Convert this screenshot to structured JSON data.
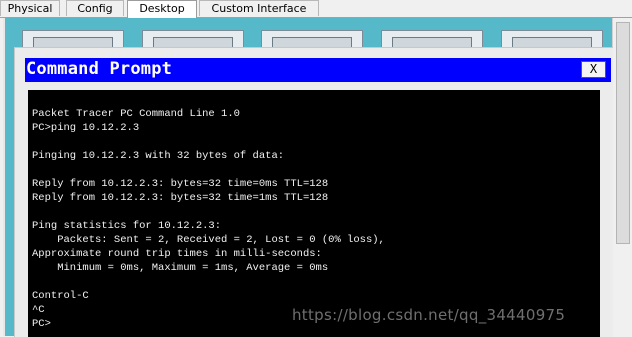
{
  "tabs": [
    {
      "label": "Physical"
    },
    {
      "label": "Config"
    },
    {
      "label": "Desktop",
      "active": true
    },
    {
      "label": "Custom Interface"
    }
  ],
  "window": {
    "title": "Command Prompt",
    "close_label": "X"
  },
  "terminal": {
    "lines": [
      "Packet Tracer PC Command Line 1.0",
      "PC>ping 10.12.2.3",
      "",
      "Pinging 10.12.2.3 with 32 bytes of data:",
      "",
      "Reply from 10.12.2.3: bytes=32 time=0ms TTL=128",
      "Reply from 10.12.2.3: bytes=32 time=1ms TTL=128",
      "",
      "Ping statistics for 10.12.2.3:",
      "    Packets: Sent = 2, Received = 2, Lost = 0 (0% loss),",
      "Approximate round trip times in milli-seconds:",
      "    Minimum = 0ms, Maximum = 1ms, Average = 0ms",
      "",
      "Control-C",
      "^C",
      "PC>"
    ]
  },
  "watermark": "https://blog.csdn.net/qq_34440975",
  "colors": {
    "desktop_bg": "#56b9c9",
    "titlebar_bg": "#0000ff",
    "terminal_bg": "#000000",
    "terminal_fg": "#f2f2f2"
  }
}
